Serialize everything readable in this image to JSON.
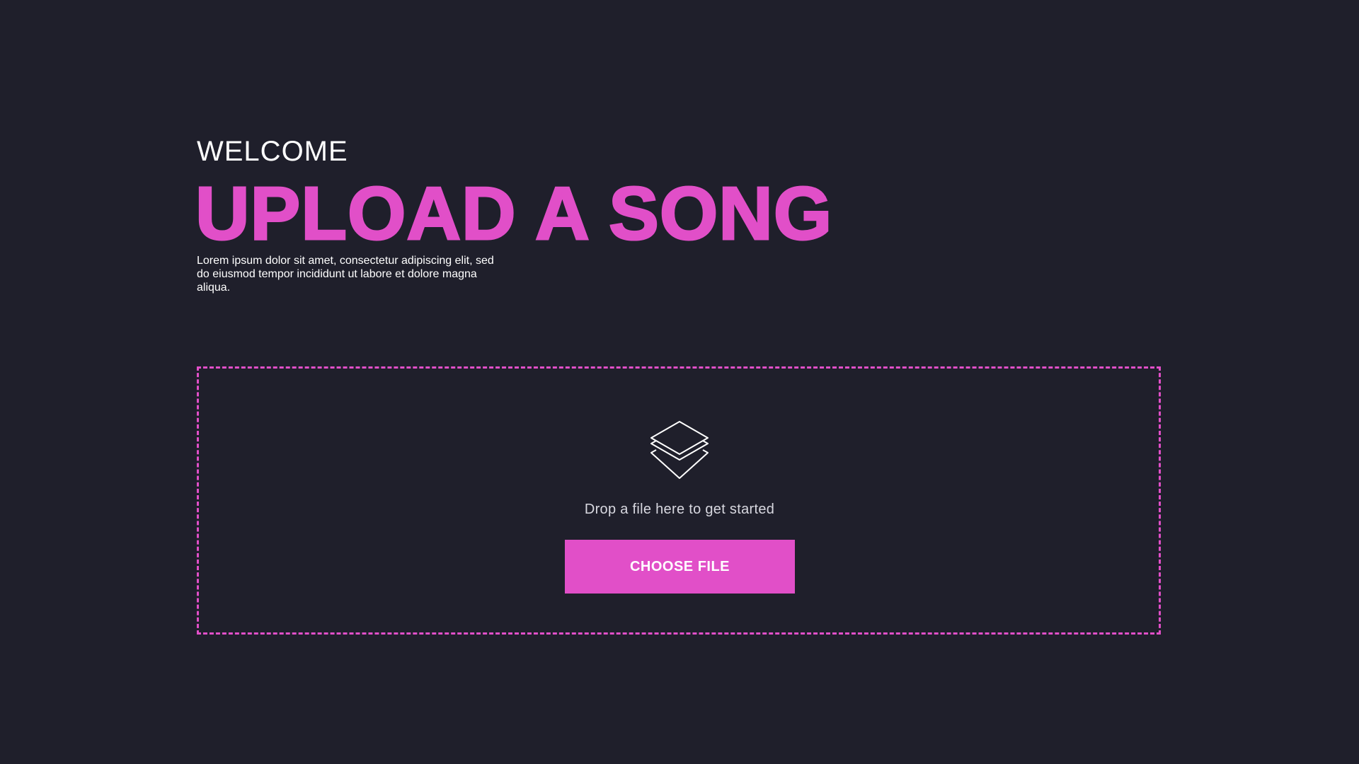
{
  "header": {
    "eyebrow": "WELCOME",
    "title": "UPLOAD A SONG",
    "description": "Lorem ipsum dolor sit amet, consectetur adipiscing elit, sed do eiusmod tempor incididunt ut labore et dolore magna aliqua."
  },
  "dropzone": {
    "icon": "layers-icon",
    "prompt": "Drop a file here to get started",
    "button_label": "CHOOSE FILE"
  },
  "colors": {
    "background": "#1f1f2b",
    "accent": "#e14fc8",
    "text": "#ffffff",
    "muted_text": "#d8d8e0"
  }
}
